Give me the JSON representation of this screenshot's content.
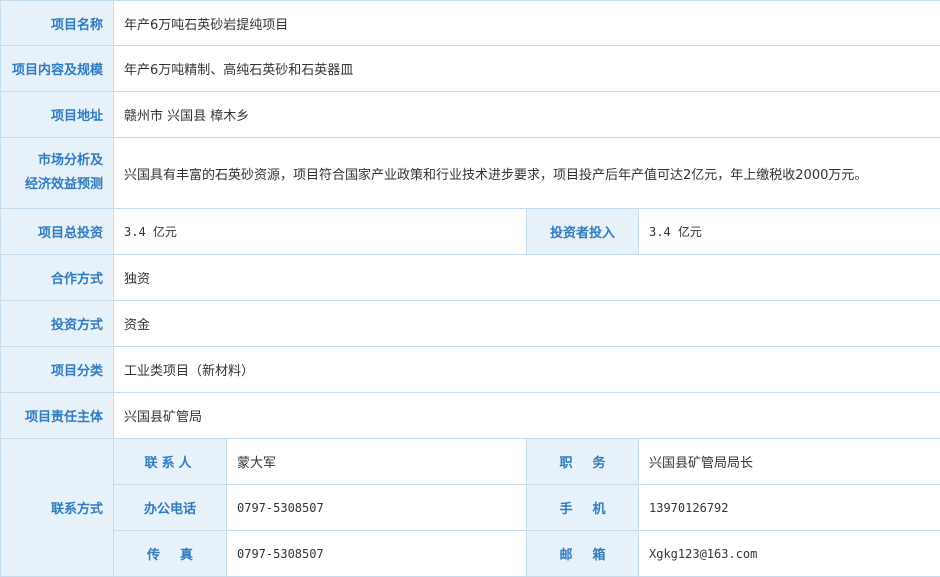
{
  "rows": {
    "name": {
      "label": "项目名称",
      "value": "年产6万吨石英砂岩提纯项目"
    },
    "scope": {
      "label": "项目内容及规模",
      "value": "年产6万吨精制、高纯石英砂和石英器皿"
    },
    "address": {
      "label": "项目地址",
      "value": "赣州市 兴国县 樟木乡"
    },
    "analysis": {
      "label_line1": "市场分析及",
      "label_line2": "经济效益预测",
      "value": "兴国具有丰富的石英砂资源，项目符合国家产业政策和行业技术进步要求，项目投产后年产值可达2亿元，年上缴税收2000万元。"
    },
    "investment": {
      "label": "项目总投资",
      "value": "3.4 亿元",
      "investor_label": "投资者投入",
      "investor_value": "3.4 亿元"
    },
    "coop": {
      "label": "合作方式",
      "value": "独资"
    },
    "invest_method": {
      "label": "投资方式",
      "value": "资金"
    },
    "category": {
      "label": "项目分类",
      "value": "工业类项目（新材料）"
    },
    "owner": {
      "label": "项目责任主体",
      "value": "兴国县矿管局"
    }
  },
  "contact": {
    "label": "联系方式",
    "person_label": "联系人",
    "person_value": "蒙大军",
    "position_label": "职务",
    "position_value": "兴国县矿管局局长",
    "office_phone_label": "办公电话",
    "office_phone_value": "0797-5308507",
    "mobile_label": "手机",
    "mobile_value": "13970126792",
    "fax_label": "传真",
    "fax_value": "0797-5308507",
    "email_label": "邮箱",
    "email_value": "Xgkg123@163.com"
  }
}
